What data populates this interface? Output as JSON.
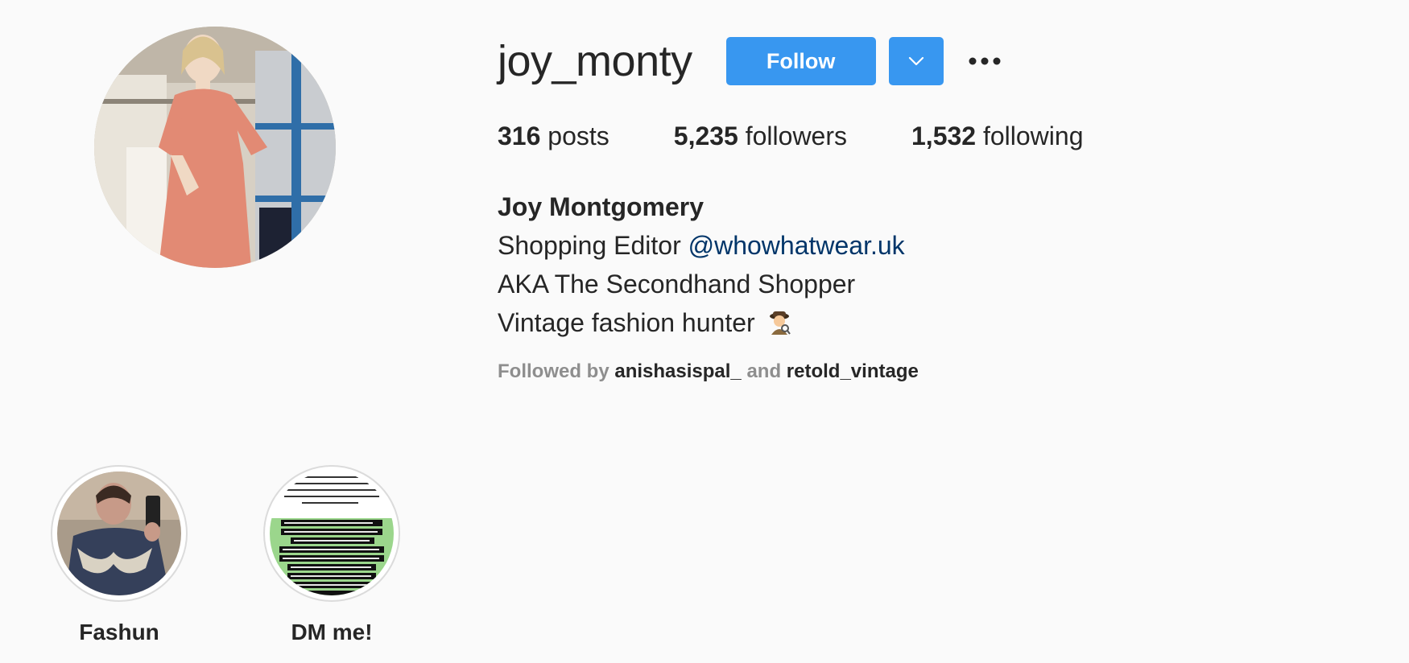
{
  "profile": {
    "username": "joy_monty",
    "follow_label": "Follow",
    "posts_count": "316",
    "posts_label": "posts",
    "followers_count": "5,235",
    "followers_label": "followers",
    "following_count": "1,532",
    "following_label": "following"
  },
  "bio": {
    "full_name": "Joy Montgomery",
    "line1_text": "Shopping Editor",
    "line1_link": "@whowhatwear.uk",
    "line2": "AKA The Secondhand Shopper",
    "line3": "Vintage fashion hunter",
    "line3_emoji": "detective-emoji"
  },
  "followed_by": {
    "prefix": "Followed by",
    "account1": "anishasispal_",
    "connector": "and",
    "account2": "retold_vintage"
  },
  "highlights": [
    {
      "label": "Fashun"
    },
    {
      "label": "DM me!"
    }
  ],
  "colors": {
    "accent": "#3897f0",
    "link": "#003569",
    "background": "#fafafa",
    "text": "#262626",
    "muted": "#8e8e8e"
  }
}
